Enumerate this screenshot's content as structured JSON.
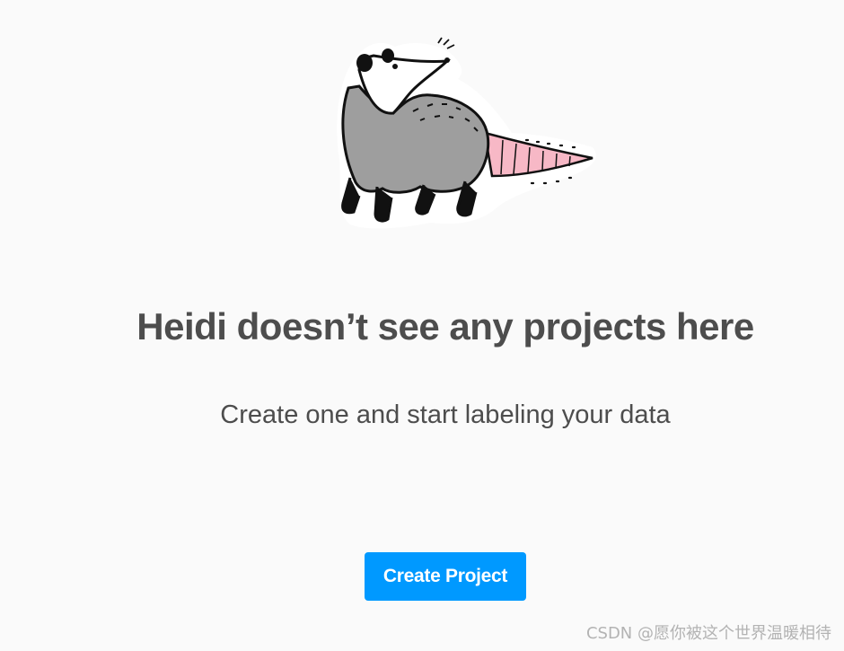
{
  "empty_state": {
    "illustration_icon": "opossum-illustration",
    "heading": "Heidi doesn’t see any projects here",
    "subheading": "Create one and start labeling your data",
    "create_button_label": "Create Project"
  },
  "watermark": {
    "text": "CSDN @愿你被这个世界温暖相待"
  },
  "colors": {
    "background": "#fafafa",
    "text": "#4d4d4d",
    "primary_button": "#0099ff",
    "opossum_body": "#9e9e9e",
    "opossum_tail": "#f7b8c6"
  }
}
